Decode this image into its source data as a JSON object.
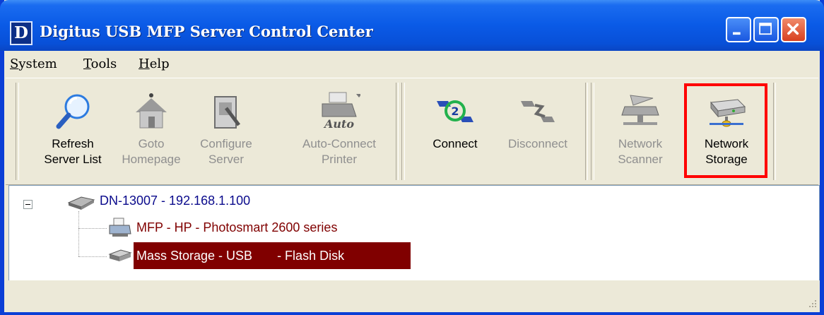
{
  "window": {
    "title": "Digitus USB MFP Server Control Center",
    "logo_letter": "D",
    "controls": [
      "minimize",
      "maximize",
      "close"
    ]
  },
  "menu": {
    "items": [
      {
        "label": "System",
        "underline": "S",
        "rest": "ystem"
      },
      {
        "label": "Tools",
        "underline": "T",
        "rest": "ools"
      },
      {
        "label": "Help",
        "underline": "H",
        "rest": "elp"
      }
    ]
  },
  "toolbar": {
    "buttons": [
      {
        "line1": "Refresh",
        "line2": "Server List",
        "icon": "magnifier-icon",
        "enabled": true
      },
      {
        "line1": "Goto",
        "line2": "Homepage",
        "icon": "house-icon",
        "enabled": false
      },
      {
        "line1": "Configure",
        "line2": "Server",
        "icon": "configure-icon",
        "enabled": false
      },
      {
        "line1": "Auto-Connect",
        "line2": "Printer",
        "icon": "auto-printer-icon",
        "enabled": false,
        "icon_text": "Auto"
      },
      {
        "line1": "Connect",
        "line2": "",
        "icon": "connect-icon",
        "enabled": true
      },
      {
        "line1": "Disconnect",
        "line2": "",
        "icon": "disconnect-icon",
        "enabled": false
      },
      {
        "line1": "Network",
        "line2": "Scanner",
        "icon": "scanner-icon",
        "enabled": false
      },
      {
        "line1": "Network",
        "line2": "Storage",
        "icon": "storage-icon",
        "enabled": true,
        "highlighted": true
      }
    ]
  },
  "tree": {
    "server": {
      "label": "DN-13007 - 192.168.1.100",
      "color": "#0a0a8c"
    },
    "devices": [
      {
        "label": "MFP - HP - Photosmart 2600 series",
        "color": "#800000",
        "selected": false
      },
      {
        "label": "Mass Storage - USB       - Flash Disk",
        "color": "#ffffff",
        "selected": true,
        "selected_bg": "#800000"
      }
    ]
  },
  "colors": {
    "title_bar": "#0a5ae6",
    "highlight_border": "#ff0000",
    "selection": "#800000"
  }
}
